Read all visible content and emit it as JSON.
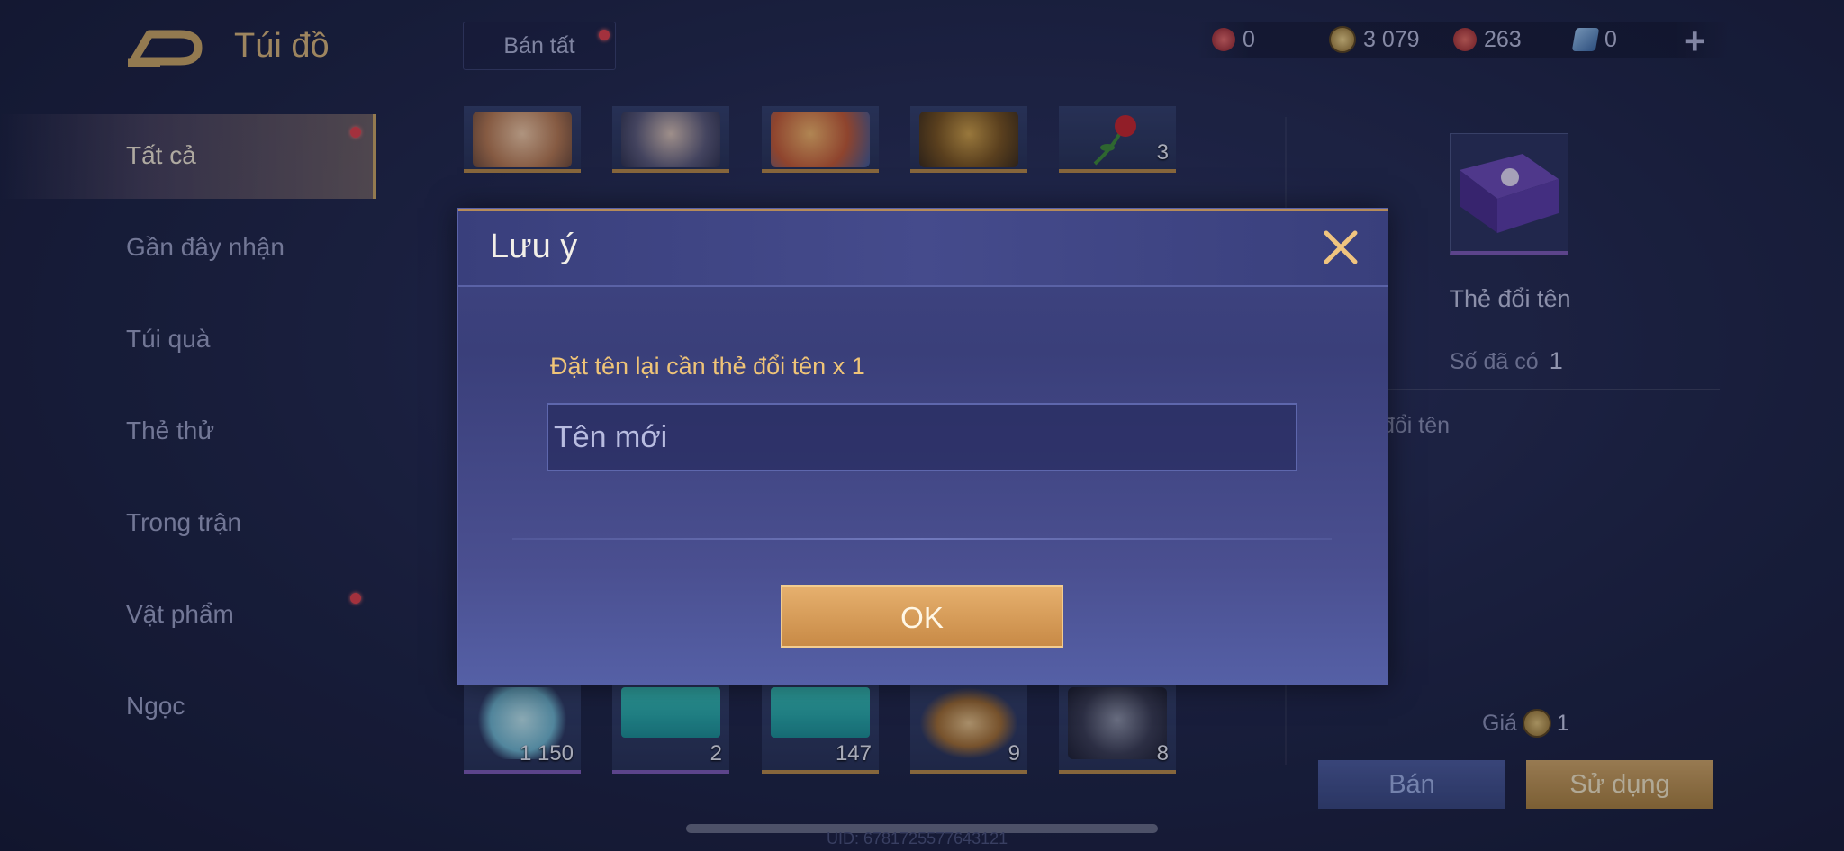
{
  "header": {
    "title": "Túi đồ",
    "sell_all_label": "Bán tất",
    "currencies": [
      {
        "icon": "red-token-icon",
        "value": "0",
        "color": "#d9434e"
      },
      {
        "icon": "gold-coin-icon",
        "value": "3 079",
        "color": "#c9a454"
      },
      {
        "icon": "red-voucher-icon",
        "value": "263",
        "color": "#c8434b"
      },
      {
        "icon": "blue-card-icon",
        "value": "0",
        "color": "#6f9fd6"
      }
    ],
    "add_label": "+"
  },
  "sidebar": {
    "items": [
      {
        "label": "Tất cả",
        "active": true,
        "dot": true
      },
      {
        "label": "Gần đây nhận"
      },
      {
        "label": "Túi quà"
      },
      {
        "label": "Thẻ thử"
      },
      {
        "label": "Trong trận"
      },
      {
        "label": "Vật phẩm",
        "dot": true
      },
      {
        "label": "Ngọc"
      }
    ]
  },
  "grid": {
    "top_row": [
      {
        "count": ""
      },
      {
        "count": ""
      },
      {
        "count": ""
      },
      {
        "count": ""
      },
      {
        "count": "3"
      }
    ],
    "bottom_row": [
      {
        "count": "1 150"
      },
      {
        "count": "2"
      },
      {
        "count": "147"
      },
      {
        "count": "9"
      },
      {
        "count": "8"
      }
    ]
  },
  "detail": {
    "item_name": "Thẻ đổi tên",
    "owned_label": "Số đã có",
    "owned_value": "1",
    "description": "đổi tên",
    "price_label": "Giá",
    "price_value": "1",
    "sell_label": "Bán",
    "use_label": "Sử dụng"
  },
  "dialog": {
    "title": "Lưu ý",
    "message": "Đặt tên lại cần thẻ đổi tên x 1",
    "input_placeholder": "Tên mới",
    "input_value": "",
    "ok_label": "OK"
  },
  "footer": {
    "uid": "UID: 6781725577643121"
  }
}
